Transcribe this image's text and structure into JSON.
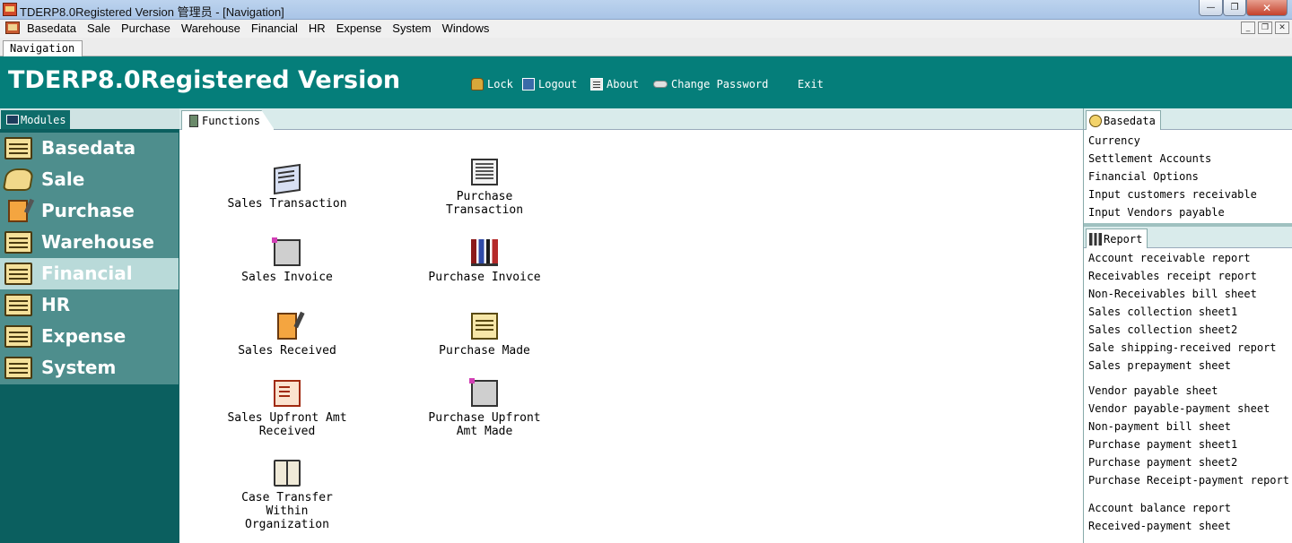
{
  "window": {
    "title": "TDERP8.0Registered Version 管理员 - [Navigation]",
    "min_label": "—",
    "max_label": "❐",
    "close_label": "✕"
  },
  "menubar": {
    "items": [
      "Basedata",
      "Sale",
      "Purchase",
      "Warehouse",
      "Financial",
      "HR",
      "Expense",
      "System",
      "Windows"
    ],
    "mdi_min": "_",
    "mdi_restore": "❐",
    "mdi_close": "✕"
  },
  "doc_tab": {
    "label": "Navigation"
  },
  "header": {
    "title": "TDERP8.0Registered Version",
    "links": {
      "lock": "Lock",
      "logout": "Logout",
      "about": "About",
      "change_password": "Change Password",
      "exit": "Exit"
    }
  },
  "modules": {
    "tab_label": "Modules",
    "items": [
      {
        "label": "Basedata",
        "icon": "folder-icon"
      },
      {
        "label": "Sale",
        "icon": "sale-icon"
      },
      {
        "label": "Purchase",
        "icon": "notepad-icon"
      },
      {
        "label": "Warehouse",
        "icon": "folder-icon"
      },
      {
        "label": "Financial",
        "icon": "folder-icon",
        "active": true
      },
      {
        "label": "HR",
        "icon": "folder-icon"
      },
      {
        "label": "Expense",
        "icon": "folder-icon"
      },
      {
        "label": "System",
        "icon": "folder-icon"
      }
    ]
  },
  "functions": {
    "tab_label": "Functions",
    "items": [
      {
        "label": "Sales Transaction",
        "icon": "documents-icon"
      },
      {
        "label": "Purchase Transaction",
        "icon": "document-stack-icon"
      },
      {
        "label": "Sales Invoice",
        "icon": "printer-icon"
      },
      {
        "label": "Purchase Invoice",
        "icon": "books-icon"
      },
      {
        "label": "Sales Received",
        "icon": "notepad-icon"
      },
      {
        "label": "Purchase Made",
        "icon": "paper-icon"
      },
      {
        "label": "Sales Upfront Amt Received",
        "icon": "form-icon"
      },
      {
        "label": "Purchase Upfront Amt Made",
        "icon": "printer-icon"
      },
      {
        "label": "Case Transfer Within Organization",
        "icon": "open-book-icon"
      }
    ]
  },
  "basedata_panel": {
    "tab_label": "Basedata",
    "items": [
      "Currency",
      "Settlement Accounts",
      "Financial Options",
      "Input customers receivable",
      "Input Vendors payable"
    ]
  },
  "report_panel": {
    "tab_label": "Report",
    "items": [
      "Account receivable report",
      "Receivables receipt report",
      "Non-Receivables bill sheet",
      "Sales collection sheet1",
      "Sales collection sheet2",
      "Sale shipping-received report",
      "Sales prepayment sheet",
      "Vendor payable sheet",
      "Vendor payable-payment sheet",
      "Non-payment bill sheet",
      "Purchase payment sheet1",
      "Purchase payment sheet2",
      "Purchase Receipt-payment report",
      "Account balance report",
      "Received-payment sheet"
    ]
  },
  "colors": {
    "banner": "#057e7a",
    "module_bg": "#4e8e8d",
    "module_active": "#b9dad9",
    "panel_dark": "#0b5f5f"
  }
}
